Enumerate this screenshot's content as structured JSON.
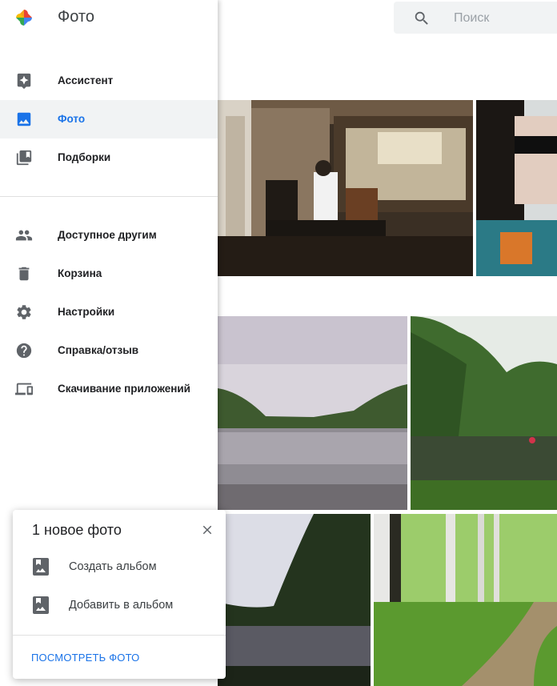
{
  "app": {
    "title": "Фото"
  },
  "search": {
    "placeholder": "Поиск",
    "icon": "search-icon"
  },
  "nav": {
    "items": [
      {
        "label": "Ассистент",
        "icon": "assistant-icon"
      },
      {
        "label": "Фото",
        "icon": "photo-icon",
        "active": true
      },
      {
        "label": "Подборки",
        "icon": "albums-icon"
      },
      {
        "label": "Доступное другим",
        "icon": "people-icon"
      },
      {
        "label": "Корзина",
        "icon": "trash-icon"
      },
      {
        "label": "Настройки",
        "icon": "gear-icon"
      },
      {
        "label": "Справка/отзыв",
        "icon": "help-icon"
      },
      {
        "label": "Скачивание приложений",
        "icon": "devices-icon"
      }
    ]
  },
  "notification": {
    "title": "1 новое фото",
    "actions": [
      {
        "label": "Создать альбом",
        "icon": "album-add-icon"
      },
      {
        "label": "Добавить в альбом",
        "icon": "album-add-icon"
      }
    ],
    "link": "ПОСМОТРЕТЬ ФОТО"
  },
  "colors": {
    "accent": "#1a73e8",
    "active_bg": "#f1f3f4",
    "icon": "#5f6368"
  }
}
